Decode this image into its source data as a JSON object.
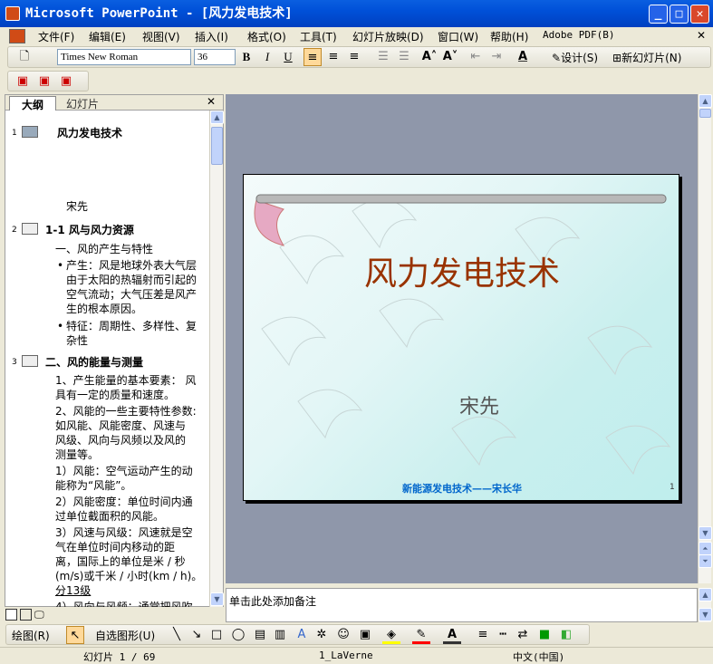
{
  "window": {
    "title": "Microsoft PowerPoint - [风力发电技术]",
    "minimize": "_",
    "maximize": "□",
    "close": "✕"
  },
  "menu": {
    "items": [
      "文件(F)",
      "编辑(E)",
      "视图(V)",
      "插入(I)",
      "格式(O)",
      "工具(T)",
      "幻灯片放映(D)",
      "窗口(W)",
      "帮助(H)",
      "Adobe PDF(B)"
    ],
    "close": "✕"
  },
  "toolbar": {
    "font_name": "Times New Roman",
    "font_size": "36",
    "bold": "B",
    "italic": "I",
    "underline": "U",
    "font_color": "A",
    "design_label": "设计(S)",
    "new_slide_label": "新幻灯片(N)"
  },
  "pane": {
    "tabs": [
      "大纲",
      "幻灯片"
    ],
    "close": "✕",
    "outline": [
      {
        "num": "1",
        "text": "风力发电技术",
        "bold": true
      },
      {
        "text": "宋先"
      },
      {
        "num": "2",
        "text": "1-1  风与风力资源",
        "bold": true
      },
      {
        "text": "一、风的产生与特性"
      },
      {
        "text": "产生：风是地球外表大气层"
      },
      {
        "text": "由于太阳的热辐射而引起的"
      },
      {
        "text": "空气流动；大气压差是风产"
      },
      {
        "text": "生的根本原因。"
      },
      {
        "text": "特征：周期性、多样性、复"
      },
      {
        "text": "杂性"
      },
      {
        "num": "3",
        "text": "二、风的能量与测量",
        "bold": true
      },
      {
        "text": "1、产生能量的基本要素： 风"
      },
      {
        "text": "具有一定的质量和速度。"
      },
      {
        "text": "2、风能的一些主要特性参数:"
      },
      {
        "text": "如风能、风能密度、风速与"
      },
      {
        "text": "风级、风向与风频以及风的"
      },
      {
        "text": "测量等。"
      },
      {
        "text": "1）风能：空气运动产生的动"
      },
      {
        "text": "能称为“风能”。"
      },
      {
        "text": "2）风能密度：单位时间内通"
      },
      {
        "text": "过单位截面积的风能。"
      },
      {
        "text": "3）风速与风级：风速就是空"
      },
      {
        "text": "气在单位时间内移动的距"
      },
      {
        "text": "离，国际上的单位是米 / 秒"
      },
      {
        "text": "(m/s)或千米 / 小时(km / h)。"
      },
      {
        "text": "分13级"
      },
      {
        "text": "4）风向与风频：通常把风吹"
      }
    ]
  },
  "slide": {
    "title": "风力发电技术",
    "subtitle": "宋先",
    "footer": "新能源发电技术——宋长华",
    "page_num": "1"
  },
  "notes": {
    "placeholder": "单击此处添加备注"
  },
  "drawing": {
    "draw_label": "绘图(R)",
    "autoshape_label": "自选图形(U)"
  },
  "status": {
    "slide_info": "幻灯片 1 / 69",
    "design": "1_LaVerne",
    "language": "中文(中国)"
  },
  "colors": {
    "title_bar": "#0050d8",
    "slide_title": "#993300",
    "footer": "#0066cc",
    "workarea": "#8f97aa"
  }
}
